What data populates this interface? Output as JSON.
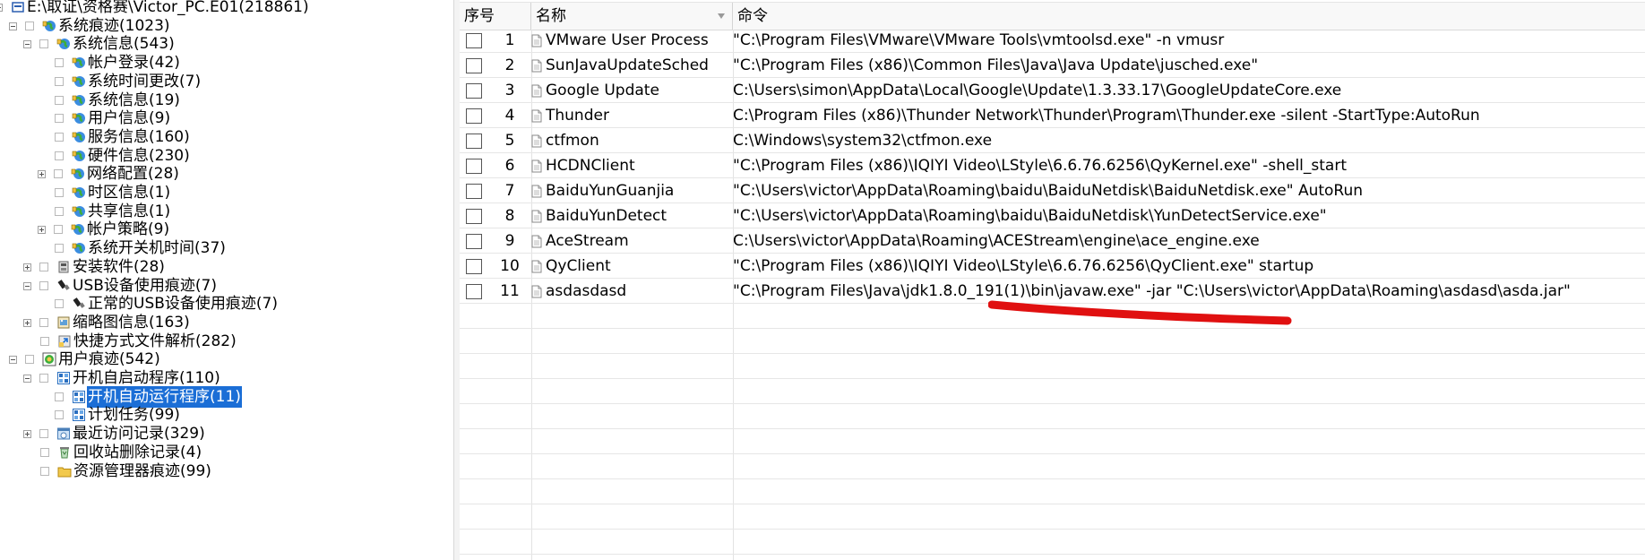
{
  "tree": {
    "items": [
      {
        "label": "E:\\取证\\资格赛\\Victor_PC.E01(218861)",
        "icon": "disk-icon",
        "expander": "minus",
        "level": 0
      },
      {
        "label": "系统痕迹(1023)",
        "icon": "globe-icon",
        "expander": "minus",
        "level": 1
      },
      {
        "label": "系统信息(543)",
        "icon": "globe-icon",
        "expander": "minus",
        "level": 2
      },
      {
        "label": "帐户登录(42)",
        "icon": "globe-icon",
        "expander": "",
        "level": 3
      },
      {
        "label": "系统时间更改(7)",
        "icon": "globe-icon",
        "expander": "",
        "level": 3
      },
      {
        "label": "系统信息(19)",
        "icon": "globe-icon",
        "expander": "",
        "level": 3
      },
      {
        "label": "用户信息(9)",
        "icon": "globe-icon",
        "expander": "",
        "level": 3
      },
      {
        "label": "服务信息(160)",
        "icon": "globe-icon",
        "expander": "",
        "level": 3
      },
      {
        "label": "硬件信息(230)",
        "icon": "globe-icon",
        "expander": "",
        "level": 3
      },
      {
        "label": "网络配置(28)",
        "icon": "globe-icon",
        "expander": "plus",
        "level": 3
      },
      {
        "label": "时区信息(1)",
        "icon": "globe-icon",
        "expander": "",
        "level": 3
      },
      {
        "label": "共享信息(1)",
        "icon": "globe-icon",
        "expander": "",
        "level": 3
      },
      {
        "label": "帐户策略(9)",
        "icon": "globe-icon",
        "expander": "plus",
        "level": 3
      },
      {
        "label": "系统开关机时间(37)",
        "icon": "globe-icon",
        "expander": "",
        "level": 3
      },
      {
        "label": "安装软件(28)",
        "icon": "installer-icon",
        "expander": "plus",
        "level": 2
      },
      {
        "label": "USB设备使用痕迹(7)",
        "icon": "usb-icon",
        "expander": "minus",
        "level": 2
      },
      {
        "label": "正常的USB设备使用痕迹(7)",
        "icon": "usb-icon",
        "expander": "",
        "level": 3
      },
      {
        "label": "缩略图信息(163)",
        "icon": "thumbnail-icon",
        "expander": "plus",
        "level": 2
      },
      {
        "label": "快捷方式文件解析(282)",
        "icon": "shortcut-icon",
        "expander": "",
        "level": 2
      },
      {
        "label": "用户痕迹(542)",
        "icon": "user-trace-icon",
        "expander": "minus",
        "level": 1
      },
      {
        "label": "开机自启动程序(110)",
        "icon": "startup-icon",
        "expander": "minus",
        "level": 2
      },
      {
        "label": "开机自动运行程序(11)",
        "icon": "startup-icon",
        "expander": "",
        "level": 3,
        "selected": true
      },
      {
        "label": "计划任务(99)",
        "icon": "startup-icon",
        "expander": "",
        "level": 3
      },
      {
        "label": "最近访问记录(329)",
        "icon": "recent-icon",
        "expander": "plus",
        "level": 2
      },
      {
        "label": "回收站删除记录(4)",
        "icon": "recycle-bin-icon",
        "expander": "",
        "level": 2
      },
      {
        "label": "资源管理器痕迹(99)",
        "icon": "folder-icon",
        "expander": "",
        "level": 2
      }
    ]
  },
  "table": {
    "headers": {
      "index": "序号",
      "name": "名称",
      "command": "命令"
    },
    "rows": [
      {
        "index": "1",
        "name": "VMware User Process",
        "command": "\"C:\\Program Files\\VMware\\VMware Tools\\vmtoolsd.exe\" -n vmusr"
      },
      {
        "index": "2",
        "name": "SunJavaUpdateSched",
        "command": "\"C:\\Program Files (x86)\\Common Files\\Java\\Java Update\\jusched.exe\""
      },
      {
        "index": "3",
        "name": "Google Update",
        "command": "C:\\Users\\simon\\AppData\\Local\\Google\\Update\\1.3.33.17\\GoogleUpdateCore.exe"
      },
      {
        "index": "4",
        "name": "Thunder",
        "command": "C:\\Program Files (x86)\\Thunder Network\\Thunder\\Program\\Thunder.exe -silent -StartType:AutoRun"
      },
      {
        "index": "5",
        "name": "ctfmon",
        "command": "C:\\Windows\\system32\\ctfmon.exe"
      },
      {
        "index": "6",
        "name": "HCDNClient",
        "command": "\"C:\\Program Files (x86)\\IQIYI Video\\LStyle\\6.6.76.6256\\QyKernel.exe\" -shell_start"
      },
      {
        "index": "7",
        "name": "BaiduYunGuanjia",
        "command": "\"C:\\Users\\victor\\AppData\\Roaming\\baidu\\BaiduNetdisk\\BaiduNetdisk.exe\" AutoRun"
      },
      {
        "index": "8",
        "name": "BaiduYunDetect",
        "command": "\"C:\\Users\\victor\\AppData\\Roaming\\baidu\\BaiduNetdisk\\YunDetectService.exe\""
      },
      {
        "index": "9",
        "name": "AceStream",
        "command": "C:\\Users\\victor\\AppData\\Roaming\\ACEStream\\engine\\ace_engine.exe"
      },
      {
        "index": "10",
        "name": "QyClient",
        "command": "\"C:\\Program Files (x86)\\IQIYI Video\\LStyle\\6.6.76.6256\\QyClient.exe\" startup"
      },
      {
        "index": "11",
        "name": "asdasdasd",
        "command": "\"C:\\Program Files\\Java\\jdk1.8.0_191(1)\\bin\\javaw.exe\" -jar \"C:\\Users\\victor\\AppData\\Roaming\\asdasd\\asda.jar\""
      }
    ]
  },
  "colors": {
    "selection": "#1b6ed6",
    "annotation_stroke": "#e01010",
    "header_bg": "#f8f8f8",
    "grid": "#e6e6e6"
  }
}
